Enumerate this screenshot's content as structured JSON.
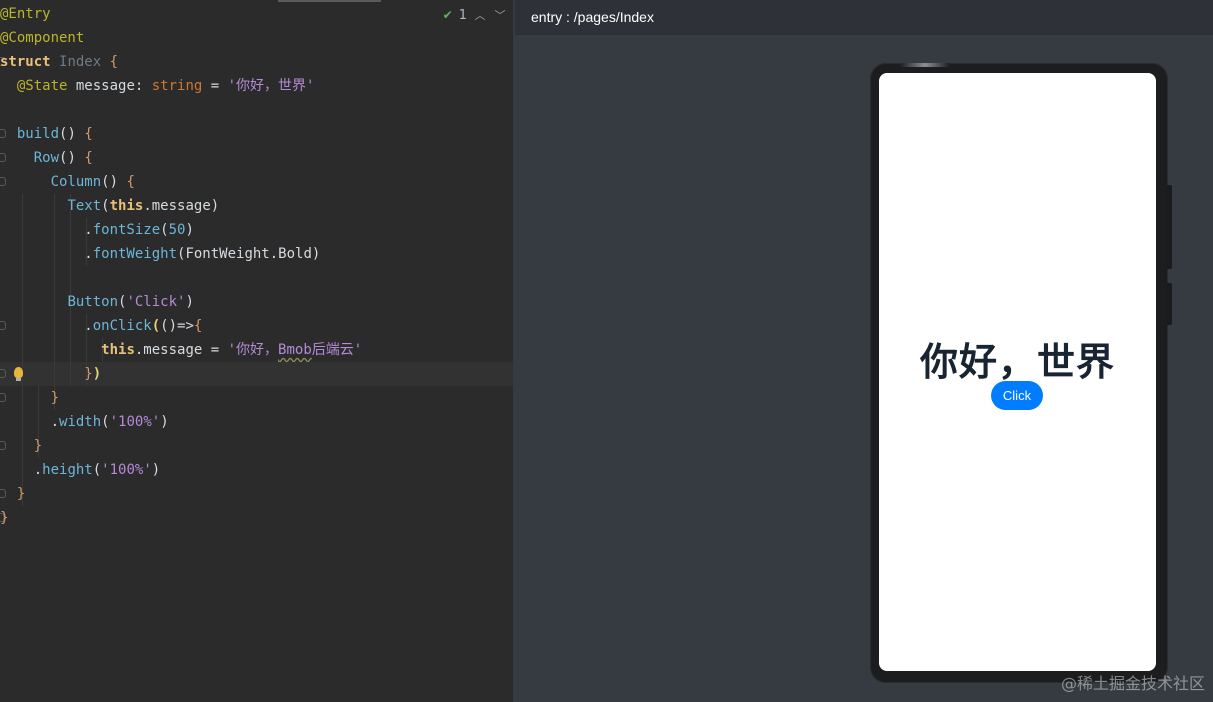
{
  "editor": {
    "status_count": "1",
    "lines": [
      [
        {
          "c": "t-ann",
          "t": "@Entry"
        }
      ],
      [
        {
          "c": "t-ann",
          "t": "@Component"
        }
      ],
      [
        {
          "c": "t-kw",
          "t": "struct "
        },
        {
          "c": "t-cls",
          "t": "Index "
        },
        {
          "c": "t-brace",
          "t": "{"
        }
      ],
      [
        {
          "c": "t-plain",
          "t": "  "
        },
        {
          "c": "t-ann",
          "t": "@State "
        },
        {
          "c": "t-plain",
          "t": "message: "
        },
        {
          "c": "t-type",
          "t": "string"
        },
        {
          "c": "t-plain",
          "t": " = "
        },
        {
          "c": "t-str",
          "t": "'你好，世界'"
        }
      ],
      [],
      [
        {
          "c": "t-plain",
          "t": "  "
        },
        {
          "c": "t-fn",
          "t": "build"
        },
        {
          "c": "t-plain",
          "t": "() "
        },
        {
          "c": "t-brace",
          "t": "{"
        }
      ],
      [
        {
          "c": "t-plain",
          "t": "    "
        },
        {
          "c": "t-fn",
          "t": "Row"
        },
        {
          "c": "t-plain",
          "t": "() "
        },
        {
          "c": "t-brace",
          "t": "{"
        }
      ],
      [
        {
          "c": "t-plain",
          "t": "      "
        },
        {
          "c": "t-fn",
          "t": "Column"
        },
        {
          "c": "t-plain",
          "t": "() "
        },
        {
          "c": "t-brace",
          "t": "{"
        }
      ],
      [
        {
          "c": "t-plain",
          "t": "        "
        },
        {
          "c": "t-fn",
          "t": "Text"
        },
        {
          "c": "t-plain",
          "t": "("
        },
        {
          "c": "t-this",
          "t": "this"
        },
        {
          "c": "t-plain",
          "t": ".message)"
        }
      ],
      [
        {
          "c": "t-plain",
          "t": "          ."
        },
        {
          "c": "t-fn",
          "t": "fontSize"
        },
        {
          "c": "t-plain",
          "t": "("
        },
        {
          "c": "t-num",
          "t": "50"
        },
        {
          "c": "t-plain",
          "t": ")"
        }
      ],
      [
        {
          "c": "t-plain",
          "t": "          ."
        },
        {
          "c": "t-fn",
          "t": "fontWeight"
        },
        {
          "c": "t-plain",
          "t": "(FontWeight.Bold)"
        }
      ],
      [],
      [
        {
          "c": "t-plain",
          "t": "        "
        },
        {
          "c": "t-fn",
          "t": "Button"
        },
        {
          "c": "t-plain",
          "t": "("
        },
        {
          "c": "t-str",
          "t": "'Click'"
        },
        {
          "c": "t-plain",
          "t": ")"
        }
      ],
      [
        {
          "c": "t-plain",
          "t": "          ."
        },
        {
          "c": "t-fn",
          "t": "onClick"
        },
        {
          "c": "t-hl",
          "t": "("
        },
        {
          "c": "t-plain",
          "t": "()=>"
        },
        {
          "c": "t-brace",
          "t": "{"
        }
      ],
      [
        {
          "c": "t-plain",
          "t": "            "
        },
        {
          "c": "t-this",
          "t": "this"
        },
        {
          "c": "t-plain",
          "t": ".message = "
        },
        {
          "c": "t-str",
          "t": "'你好，"
        },
        {
          "c": "t-str t-ul",
          "t": "Bmob"
        },
        {
          "c": "t-str",
          "t": "后端云'"
        }
      ],
      [
        {
          "c": "t-plain",
          "t": "          "
        },
        {
          "c": "t-brace",
          "t": "}"
        },
        {
          "c": "t-hl",
          "t": ")"
        }
      ],
      [
        {
          "c": "t-plain",
          "t": "      "
        },
        {
          "c": "t-brace",
          "t": "}"
        }
      ],
      [
        {
          "c": "t-plain",
          "t": "      ."
        },
        {
          "c": "t-fn",
          "t": "width"
        },
        {
          "c": "t-plain",
          "t": "("
        },
        {
          "c": "t-str",
          "t": "'100%'"
        },
        {
          "c": "t-plain",
          "t": ")"
        }
      ],
      [
        {
          "c": "t-plain",
          "t": "    "
        },
        {
          "c": "t-brace",
          "t": "}"
        }
      ],
      [
        {
          "c": "t-plain",
          "t": "    ."
        },
        {
          "c": "t-fn",
          "t": "height"
        },
        {
          "c": "t-plain",
          "t": "("
        },
        {
          "c": "t-str",
          "t": "'100%'"
        },
        {
          "c": "t-plain",
          "t": ")"
        }
      ],
      [
        {
          "c": "t-plain",
          "t": "  "
        },
        {
          "c": "t-brace",
          "t": "}"
        }
      ],
      [
        {
          "c": "t-brace",
          "t": "}"
        }
      ]
    ]
  },
  "preview": {
    "path": "entry : /pages/Index",
    "screen_title": "你好，世界",
    "button_label": "Click"
  },
  "watermark": "@稀土掘金技术社区",
  "colors": {
    "accent": "#007dff",
    "editor_bg": "#2b2b2b",
    "preview_bg": "#363b42"
  },
  "icons": [
    "check-icon",
    "chevron-up-icon",
    "chevron-down-icon",
    "lightbulb-icon",
    "fold-marker-icon"
  ]
}
